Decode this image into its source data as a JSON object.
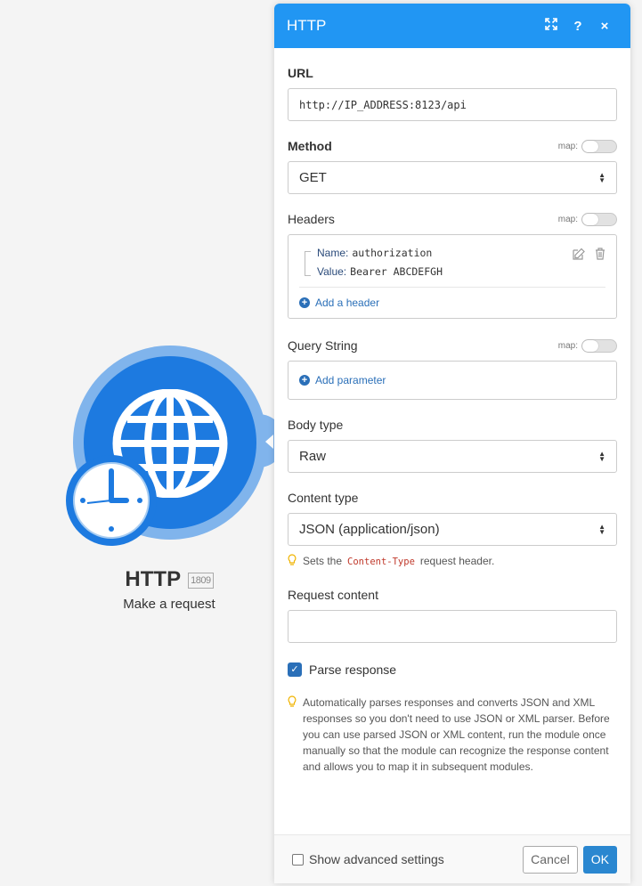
{
  "module": {
    "title": "HTTP",
    "badge": "1809",
    "subtitle": "Make a request"
  },
  "panel": {
    "title": "HTTP",
    "url": {
      "label": "URL",
      "value": "http://IP_ADDRESS:8123/api"
    },
    "map_label": "map:",
    "method": {
      "label": "Method",
      "value": "GET"
    },
    "headers": {
      "label": "Headers",
      "items": [
        {
          "name_label": "Name:",
          "name": "authorization",
          "value_label": "Value:",
          "value": "Bearer ABCDEFGH"
        }
      ],
      "add_label": "Add a header"
    },
    "query": {
      "label": "Query String",
      "add_label": "Add parameter"
    },
    "body_type": {
      "label": "Body type",
      "value": "Raw"
    },
    "content_type": {
      "label": "Content type",
      "value": "JSON (application/json)",
      "hint_pre": "Sets the",
      "hint_code": "Content-Type",
      "hint_post": "request header."
    },
    "request_content": {
      "label": "Request content",
      "value": ""
    },
    "parse_response": {
      "label": "Parse response",
      "checked": true,
      "hint": "Automatically parses responses and converts JSON and XML responses so you don't need to use JSON or XML parser. Before you can use parsed JSON or XML content, run the module once manually so that the module can recognize the response content and allows you to map it in subsequent modules."
    },
    "footer": {
      "advanced_label": "Show advanced settings",
      "cancel": "Cancel",
      "ok": "OK"
    }
  },
  "colors": {
    "header": "#2196f3",
    "module": "#1d7ae0",
    "link": "#2a6fb8"
  }
}
